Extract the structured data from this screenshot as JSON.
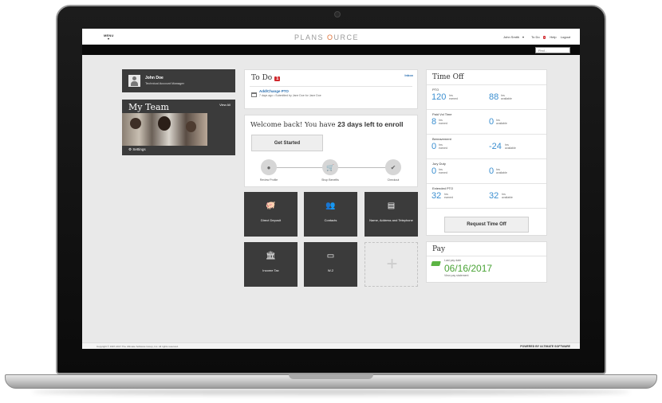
{
  "topbar": {
    "menu": "MENU",
    "logo_left": "PLANS",
    "logo_mid": "O",
    "logo_right": "URCE",
    "links": {
      "user": "John Smith",
      "todo": "To Do",
      "todo_count": "1",
      "help": "Help",
      "logout": "Logout"
    },
    "find_placeholder": "Find..."
  },
  "user": {
    "name": "John Doe",
    "title": "Technical Account Manager"
  },
  "team": {
    "title": "My Team",
    "view_all": "View All",
    "settings": "Settings"
  },
  "todo": {
    "title": "To Do",
    "count": "1",
    "inbox": "Inbox",
    "item_title": "Add/Change PTO",
    "item_meta": "7 days ago • Submitted by Jane Doe for Jane Doe"
  },
  "welcome": {
    "text_before": "Welcome back! You have ",
    "text_bold": "23 days left to enroll",
    "button": "Get Started",
    "steps": [
      "Review Profile",
      "Shop Benefits",
      "Checkout"
    ]
  },
  "tiles": [
    {
      "label": "Direct Deposit",
      "icon": "piggy-bank-icon"
    },
    {
      "label": "Contacts",
      "icon": "contacts-icon"
    },
    {
      "label": "Name, Address and Telephone",
      "icon": "id-card-icon"
    },
    {
      "label": "Income Tax",
      "icon": "bank-building-icon"
    },
    {
      "label": "W-2",
      "icon": "w2-form-icon"
    }
  ],
  "timeoff": {
    "title": "Time Off",
    "rows": [
      {
        "name": "PTO",
        "earned": "120",
        "available": "88"
      },
      {
        "name": "Paid Vol Time",
        "earned": "8",
        "available": "0"
      },
      {
        "name": "Bereavement",
        "earned": "0",
        "available": "-24"
      },
      {
        "name": "Jury Duty",
        "earned": "0",
        "available": "0"
      },
      {
        "name": "Extended PTO",
        "earned": "32",
        "available": "32"
      }
    ],
    "unit_hrs": "hrs",
    "unit_earned": "earned",
    "unit_available": "available",
    "button": "Request Time Off"
  },
  "pay": {
    "title": "Pay",
    "label": "Last pay date",
    "date": "06/16/2017",
    "link": "View pay statement"
  },
  "footer": {
    "copyright": "Copyright © 1997-2017 The Ultimate Software Group, Inc. All rights reserved.",
    "powered": "POWERED BY ULTIMATE SOFTWARE"
  },
  "colors": {
    "accent_blue": "#3a8ed0",
    "pay_green": "#4aa336",
    "alert_red": "#d0282d",
    "logo_orange": "#e0753c",
    "tile_dark": "#3b3b3b"
  }
}
